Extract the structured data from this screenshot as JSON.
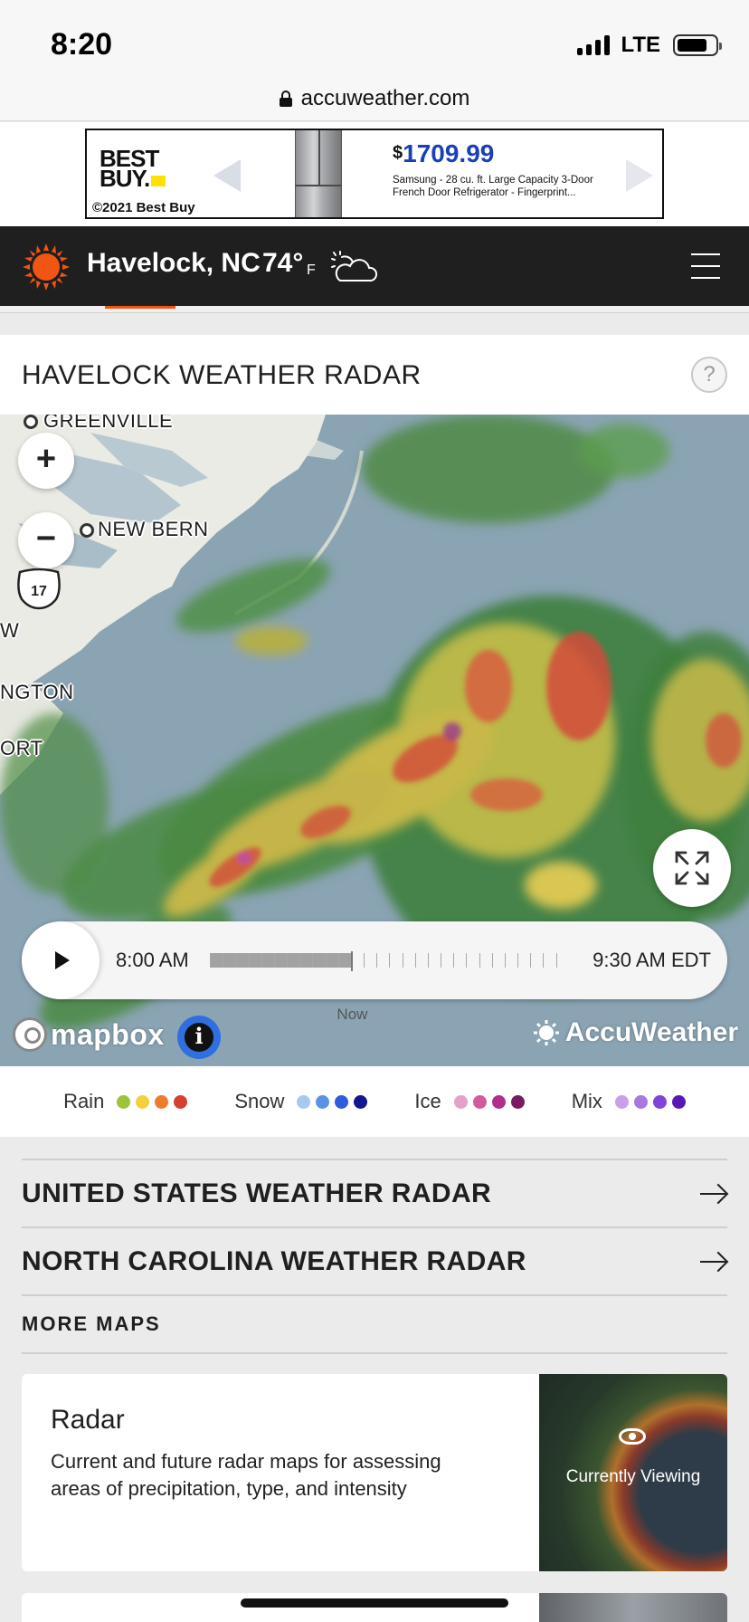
{
  "status_bar": {
    "time": "8:20",
    "network": "LTE"
  },
  "browser": {
    "url": "accuweather.com"
  },
  "ad": {
    "brand_line1": "BEST",
    "brand_line2": "BUY.",
    "copyright": "©2021 Best Buy",
    "currency": "$",
    "price": "1709.99",
    "description": "Samsung - 28 cu. ft. Large Capacity 3-Door French Door Refrigerator - Fingerprint..."
  },
  "header": {
    "location": "Havelock, NC",
    "temperature": "74°",
    "unit": "F",
    "condition_icon": "partly-cloudy-icon",
    "accent_color": "#f05514"
  },
  "radar": {
    "title": "HAVELOCK WEATHER RADAR",
    "help_label": "?",
    "map_labels": {
      "greenville": "GREENVILLE",
      "new_bern": "NEW BERN",
      "highway": "17",
      "partial_w": "W",
      "partial_ington": "NGTON",
      "partial_ort": "ORT"
    },
    "zoom_in_label": "+",
    "zoom_out_label": "−",
    "timeline": {
      "start": "8:00 AM",
      "end": "9:30 AM EDT",
      "now_label": "Now",
      "progress_fraction": 0.41
    },
    "attribution": "mapbox",
    "info_label": "i",
    "watermark": "AccuWeather"
  },
  "legend": [
    {
      "label": "Rain",
      "colors": [
        "#9cc43a",
        "#f2d13a",
        "#ee7a30",
        "#d6412f"
      ]
    },
    {
      "label": "Snow",
      "colors": [
        "#a9c8ef",
        "#5b92e5",
        "#2f5bde",
        "#12168f"
      ]
    },
    {
      "label": "Ice",
      "colors": [
        "#e3a2c8",
        "#d25a9e",
        "#b02f8b",
        "#7a1a62"
      ]
    },
    {
      "label": "Mix",
      "colors": [
        "#c7a0e8",
        "#a878e0",
        "#7f45d6",
        "#5a17b8"
      ]
    }
  ],
  "links": [
    {
      "label": "UNITED STATES WEATHER RADAR"
    },
    {
      "label": "NORTH CAROLINA WEATHER RADAR"
    }
  ],
  "more_maps": {
    "heading": "MORE MAPS",
    "cards": [
      {
        "title": "Radar",
        "description": "Current and future radar maps for assessing areas of precipitation, type, and intensity",
        "badge": "Currently Viewing"
      }
    ]
  }
}
